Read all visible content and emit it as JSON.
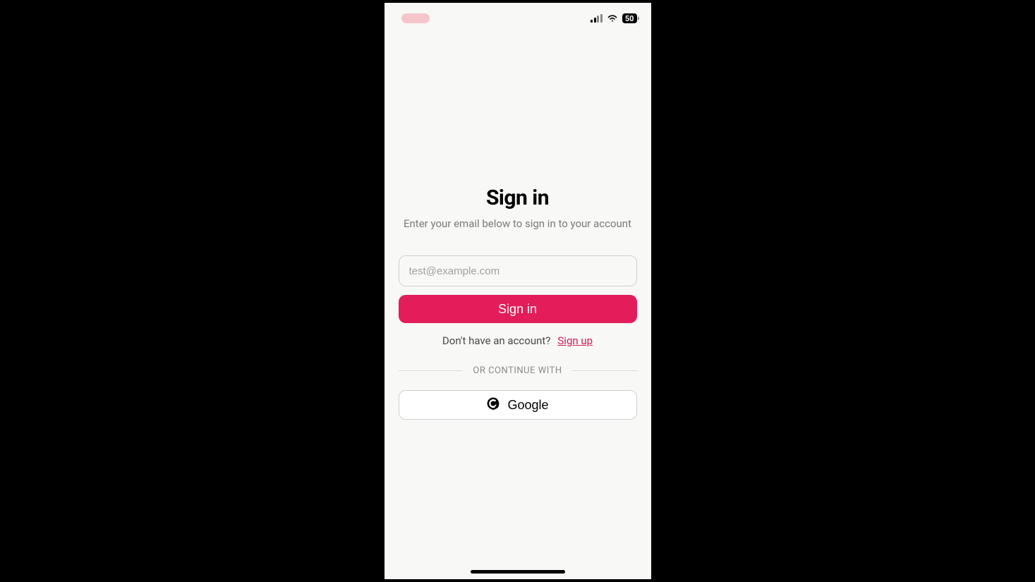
{
  "statusBar": {
    "battery": "50"
  },
  "auth": {
    "title": "Sign in",
    "subtitle": "Enter your email below to sign in to your account",
    "emailPlaceholder": "test@example.com",
    "signInButton": "Sign in",
    "noAccountText": "Don't have an account?",
    "signUpLink": "Sign up",
    "dividerText": "OR CONTINUE WITH",
    "googleButton": "Google"
  },
  "colors": {
    "accent": "#e21d5a",
    "background": "#f8f8f6"
  }
}
